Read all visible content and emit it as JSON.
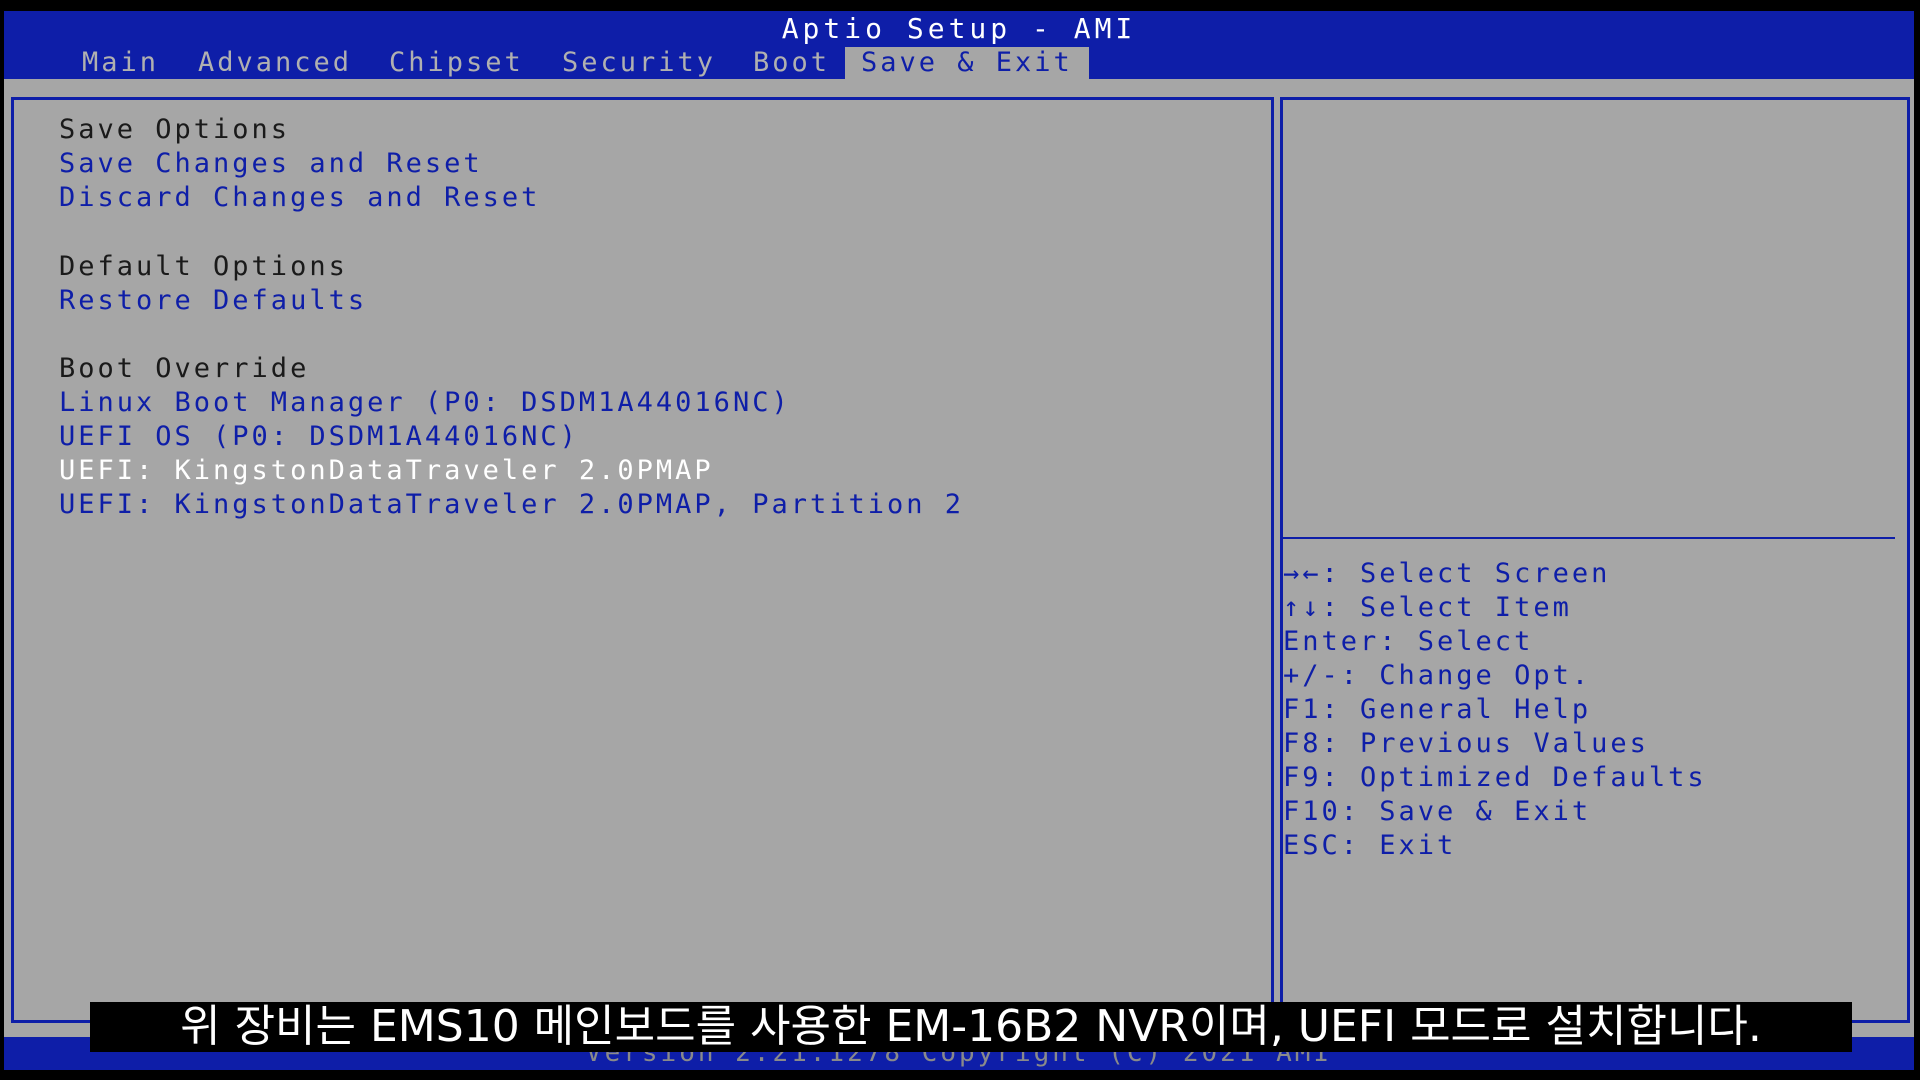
{
  "title": "Aptio Setup - AMI",
  "tabs": [
    {
      "label": "Main"
    },
    {
      "label": "Advanced"
    },
    {
      "label": "Chipset"
    },
    {
      "label": "Security"
    },
    {
      "label": "Boot"
    },
    {
      "label": "Save & Exit",
      "active": true
    }
  ],
  "menu": {
    "save_options_header": "Save Options",
    "save_changes_reset": "Save Changes and Reset",
    "discard_changes_reset": "Discard Changes and Reset",
    "default_options_header": "Default Options",
    "restore_defaults": "Restore Defaults",
    "boot_override_header": "Boot Override",
    "boot_items": [
      "Linux Boot Manager (P0: DSDM1A44016NC)",
      "UEFI OS (P0: DSDM1A44016NC)",
      "UEFI: KingstonDataTraveler 2.0PMAP",
      "UEFI: KingstonDataTraveler 2.0PMAP, Partition 2"
    ],
    "selected_boot_item_index": 2
  },
  "help": [
    "→←: Select Screen",
    "↑↓: Select Item",
    "Enter: Select",
    "+/-: Change Opt.",
    "F1: General Help",
    "F8: Previous Values",
    "F9: Optimized Defaults",
    "F10: Save & Exit",
    "ESC: Exit"
  ],
  "version": "Version 2.21.1278 Copyright (C) 2021 AMI",
  "subtitle": "위 장비는 EMS10 메인보드를 사용한 EM-16B2 NVR이며, UEFI 모드로 설치합니다.",
  "colors": {
    "bios_blue": "#0e1ea8",
    "panel_gray": "#a6a6a6",
    "selected_white": "#ffffff"
  }
}
